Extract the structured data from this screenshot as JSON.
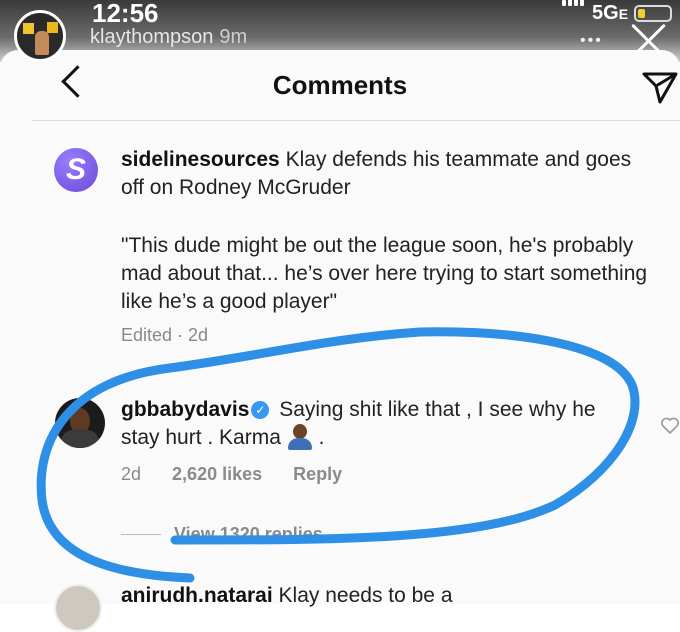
{
  "status_bar": {
    "time": "12:56",
    "network": "5G",
    "network_suffix": "E"
  },
  "story": {
    "username": "klaythompson",
    "ago": "9m",
    "more": "•••"
  },
  "header": {
    "title": "Comments"
  },
  "caption": {
    "username": "sidelinesources",
    "avatar_letter": "S",
    "text": "Klay defends his teammate and goes off on Rodney McGruder",
    "quote": "\"This dude might be out the league soon, he's probably mad about that... he’s over here trying to start something like he’s a good player\"",
    "edited": "Edited · 2d"
  },
  "comments": [
    {
      "username": "gbbabydavis",
      "verified": true,
      "text": "Saying shit like that , I see why he stay hurt .  Karma",
      "text_end": ".",
      "time": "2d",
      "likes": "2,620 likes",
      "reply": "Reply",
      "view_replies": "View 1320 replies"
    },
    {
      "username": "anirudh.natarai",
      "text": "Klay needs to be a"
    }
  ],
  "colors": {
    "markup_blue": "#2e8fe6",
    "avatar_purple": "#7b5ce6",
    "verified_blue": "#3897f0"
  },
  "icons": [
    "back-arrow-icon",
    "share-direct-icon",
    "close-icon",
    "heart-icon",
    "verified-icon",
    "signal-icon",
    "battery-icon"
  ]
}
